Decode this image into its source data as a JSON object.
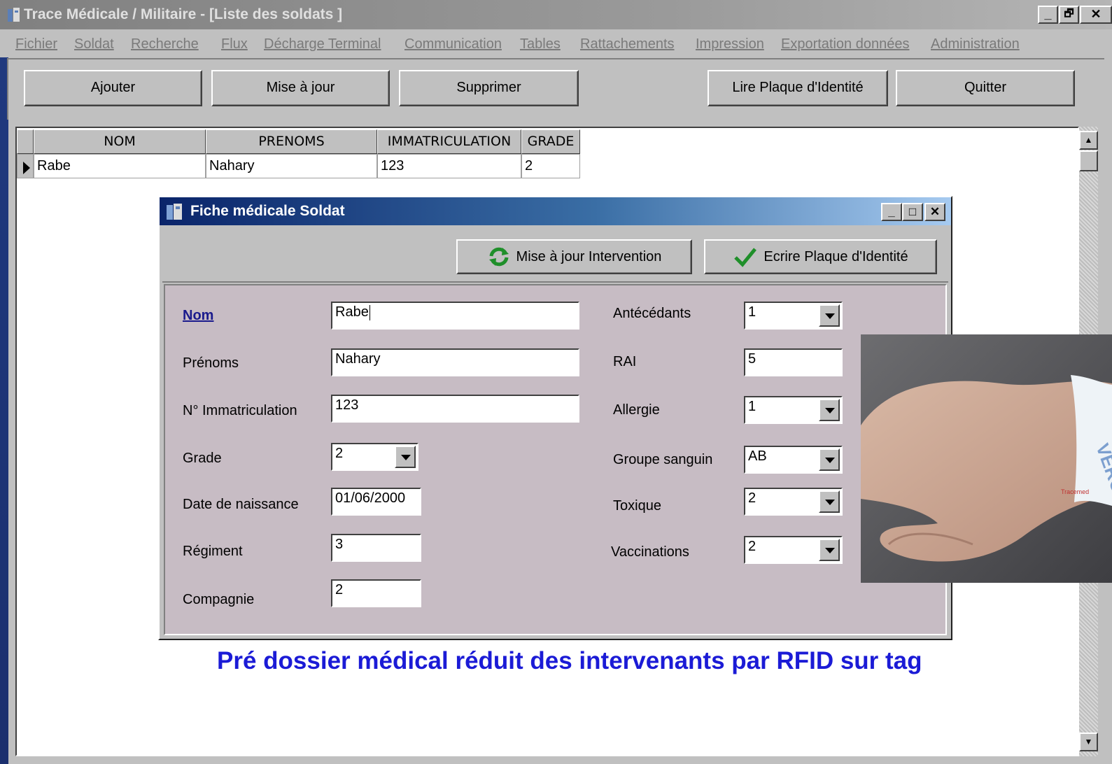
{
  "window": {
    "title": "Trace Médicale / Militaire - [Liste des soldats ]",
    "controls": {
      "minimize": "_",
      "restore": "🗗",
      "close": "✕"
    }
  },
  "menu": [
    "Fichier",
    "Soldat",
    "Recherche",
    "Flux",
    "Décharge Terminal",
    "Communication",
    "Tables",
    "Rattachements",
    "Impression",
    "Exportation données",
    "Administration"
  ],
  "toolbar": {
    "add": "Ajouter",
    "update": "Mise à jour",
    "delete": "Supprimer",
    "read_tag": "Lire Plaque d'Identité",
    "quit": "Quitter"
  },
  "grid": {
    "headers": [
      "NOM",
      "PRENOMS",
      "IMMATRICULATION",
      "GRADE"
    ],
    "rows": [
      [
        "Rabe",
        "Nahary",
        "123",
        "2"
      ]
    ]
  },
  "dialog": {
    "title": "Fiche médicale Soldat",
    "update_intervention": "Mise à jour Intervention",
    "write_tag": "Ecrire Plaque d'Identité",
    "labels": {
      "nom": "Nom",
      "prenoms": "Prénoms",
      "immat": "N° Immatriculation",
      "grade": "Grade",
      "naissance": "Date de naissance",
      "regiment": "Régiment",
      "compagnie": "Compagnie",
      "antecedants": "Antécédants",
      "rai": "RAI",
      "allergie": "Allergie",
      "groupe": "Groupe sanguin",
      "toxique": "Toxique",
      "vaccinations": "Vaccinations"
    },
    "values": {
      "nom": "Rabe",
      "prenoms": "Nahary",
      "immat": "123",
      "grade": "2",
      "naissance": "01/06/2000",
      "regiment": "3",
      "compagnie": "2",
      "antecedants": "1",
      "rai": "5",
      "allergie": "1",
      "groupe": "AB",
      "toxique": "2",
      "vaccinations": "2"
    }
  },
  "photo_text": {
    "band_text": "VERO",
    "band_small": "Tracemed"
  },
  "caption": "Pré dossier médical réduit des intervenants par RFID sur tag"
}
